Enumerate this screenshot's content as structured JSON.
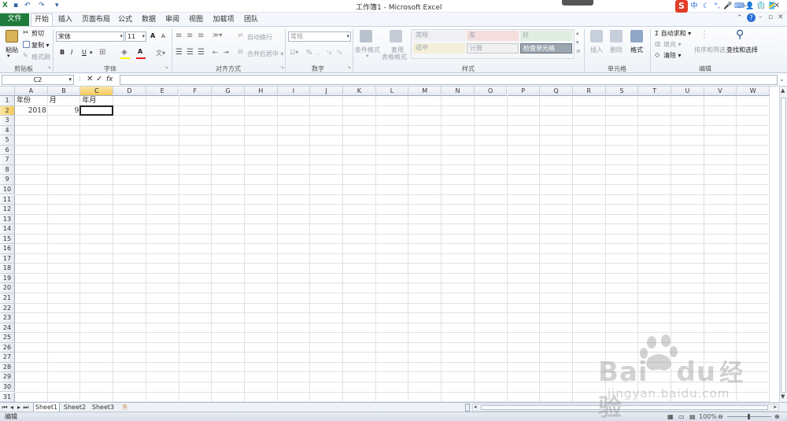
{
  "titlebar": {
    "title": "工作簿1 - Microsoft Excel",
    "ime": [
      "中",
      "☾",
      "°,",
      "🎤",
      "⌨",
      "👤",
      "👕",
      "🎽"
    ]
  },
  "tabs": [
    "文件",
    "开始",
    "插入",
    "页面布局",
    "公式",
    "数据",
    "审阅",
    "视图",
    "加载项",
    "团队"
  ],
  "ribbon": {
    "clipboard": {
      "paste": "粘贴",
      "cut": "剪切",
      "copy": "复制 ▾",
      "format_painter": "格式刷",
      "label": "剪贴板"
    },
    "font": {
      "name": "宋体",
      "size": "11",
      "label": "字体",
      "grow": "A",
      "shrink": "A",
      "bold": "B",
      "italic": "I",
      "underline": "U",
      "fontcolor": "A"
    },
    "alignment": {
      "wrap": "自动换行",
      "merge": "合并后居中 ▾",
      "label": "对齐方式"
    },
    "number": {
      "format": "常规",
      "label": "数字",
      "pct": "%",
      "comma": ","
    },
    "styles": {
      "cond": "条件格式",
      "table1": "套用",
      "table2": "表格格式",
      "cells": [
        "常规",
        "差",
        "好",
        "适中",
        "计算",
        "检查单元格"
      ],
      "label": "样式"
    },
    "cells": {
      "insert": "插入",
      "delete": "删除",
      "format": "格式",
      "label": "单元格"
    },
    "editing": {
      "autosum": "Σ 自动求和 ▾",
      "fill": "填充 ▾",
      "clear": "清除 ▾",
      "sort": "排序和筛选",
      "find": "查找和选择",
      "label": "编辑"
    }
  },
  "formula_bar": {
    "name_box": "C2",
    "fx": "fx",
    "content": ""
  },
  "columns": [
    "A",
    "B",
    "C",
    "D",
    "E",
    "F",
    "G",
    "H",
    "I",
    "J",
    "K",
    "L",
    "M",
    "N",
    "O",
    "P",
    "Q",
    "R",
    "S",
    "T",
    "U",
    "V",
    "W"
  ],
  "rows": [
    "1",
    "2",
    "3",
    "4",
    "5",
    "6",
    "7",
    "8",
    "9",
    "10",
    "11",
    "12",
    "13",
    "14",
    "15",
    "16",
    "17",
    "18",
    "19",
    "20",
    "21",
    "22",
    "23",
    "24",
    "25",
    "26",
    "27",
    "28",
    "29",
    "30",
    "31"
  ],
  "cells": {
    "A1": "年份",
    "B1": "月",
    "C1": "年月",
    "A2": "2018",
    "B2": "9"
  },
  "active_cell": "C2",
  "sheets": [
    "Sheet1",
    "Sheet2",
    "Sheet3"
  ],
  "status": {
    "mode": "编辑",
    "zoom": "100%"
  },
  "watermark": {
    "brand": "Bai",
    "brand2": "du",
    "cn": "经验",
    "url": "jingyan.baidu.com"
  },
  "colors": {
    "accent": "#1e7b3a",
    "selection": "#f5c95a",
    "ribbon_bg": "#eef2f7"
  }
}
